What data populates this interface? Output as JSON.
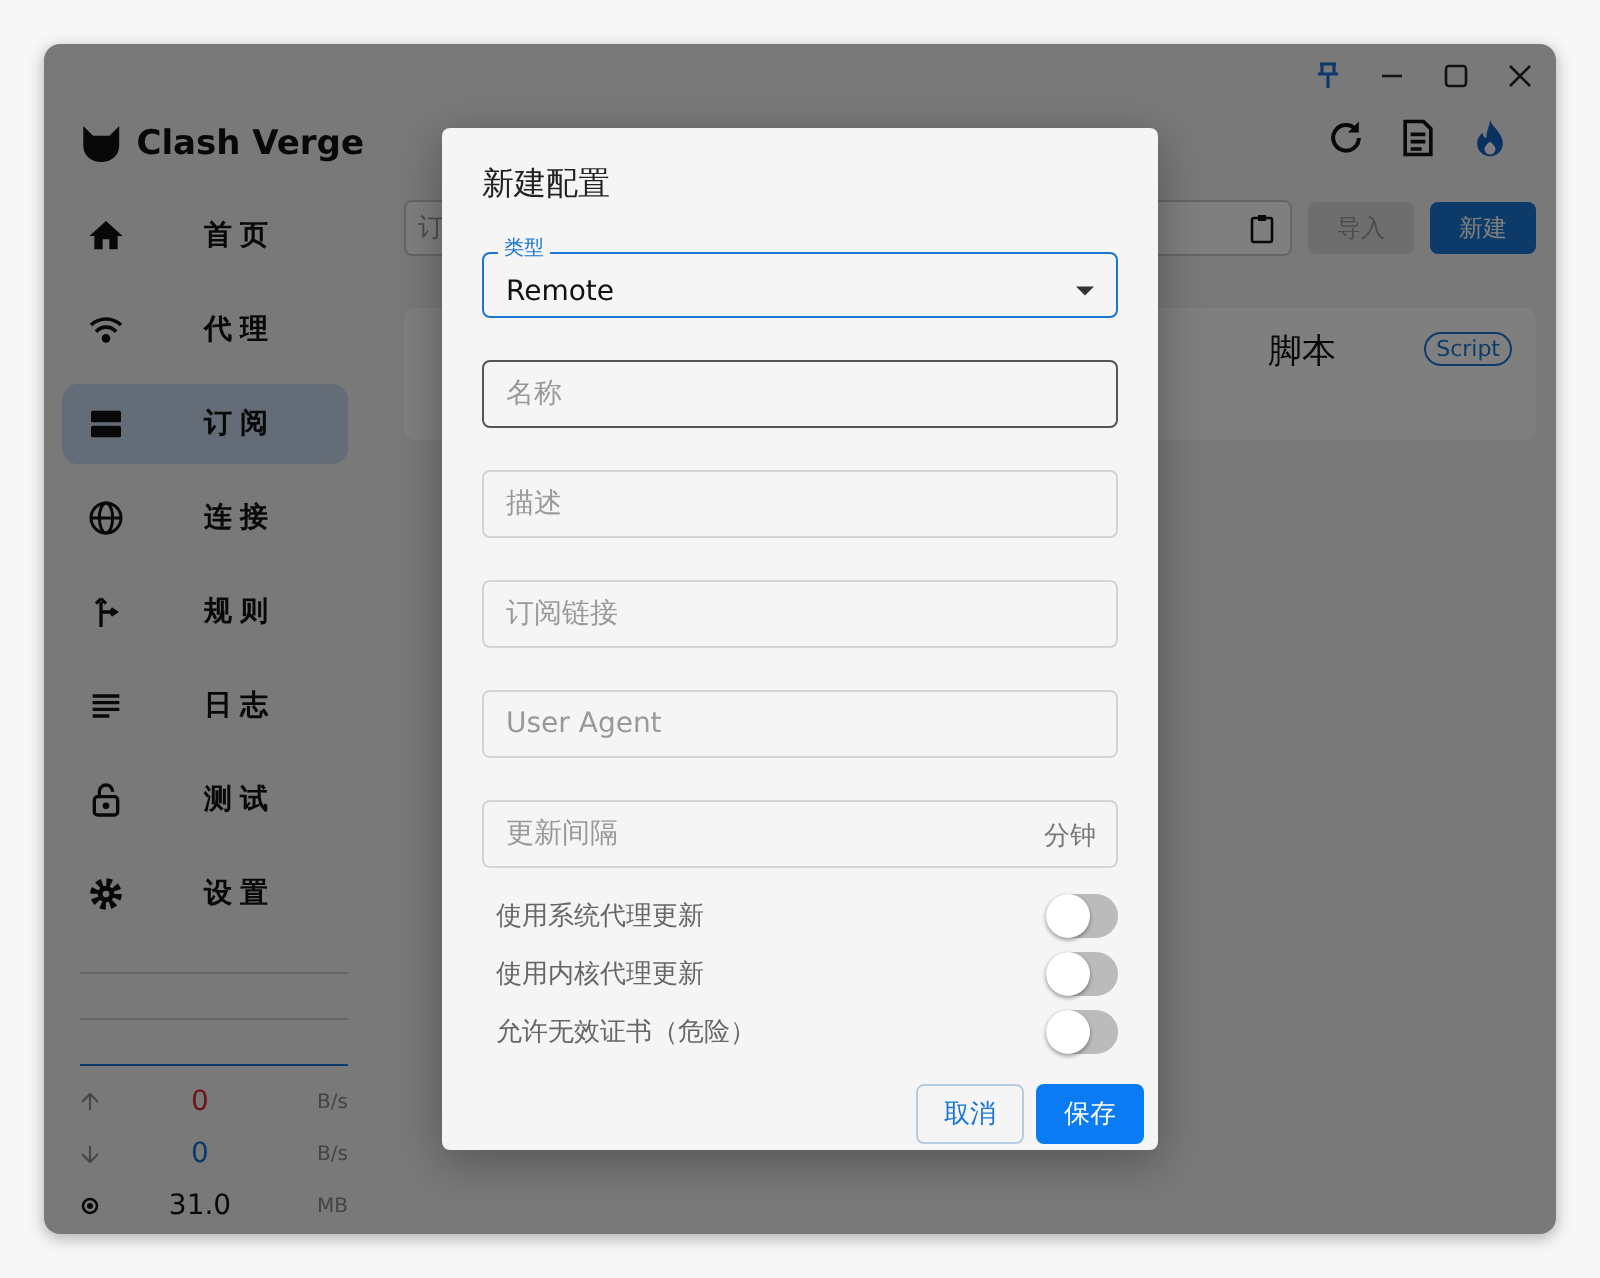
{
  "app": {
    "name": "Clash Verge"
  },
  "nav": [
    {
      "label": "首页",
      "selected": false
    },
    {
      "label": "代理",
      "selected": false
    },
    {
      "label": "订阅",
      "selected": true
    },
    {
      "label": "连接",
      "selected": false
    },
    {
      "label": "规则",
      "selected": false
    },
    {
      "label": "日志",
      "selected": false
    },
    {
      "label": "测试",
      "selected": false
    },
    {
      "label": "设置",
      "selected": false
    }
  ],
  "traffic": {
    "upload": "0",
    "upload_unit": "B/s",
    "download": "0",
    "download_unit": "B/s",
    "memory": "31.0",
    "memory_unit": "MB"
  },
  "page": {
    "search_placeholder": "订",
    "buttons": [
      {
        "label": "导入",
        "kind": "secondary"
      },
      {
        "label": "新建",
        "kind": "primary"
      }
    ],
    "card": {
      "text_right": "脚本",
      "tag": "Script"
    }
  },
  "dialog": {
    "title": "新建配置",
    "type_field": {
      "label": "类型",
      "value": "Remote"
    },
    "fields": [
      {
        "placeholder": "名称",
        "hovered": true
      },
      {
        "placeholder": "描述",
        "hovered": false
      },
      {
        "placeholder": "订阅链接",
        "hovered": false
      },
      {
        "placeholder": "User Agent",
        "hovered": false
      },
      {
        "placeholder": "更新间隔",
        "suffix": "分钟",
        "hovered": false
      }
    ],
    "toggles": [
      {
        "label": "使用系统代理更新",
        "on": false
      },
      {
        "label": "使用内核代理更新",
        "on": false
      },
      {
        "label": "允许无效证书（危险）",
        "on": false
      }
    ],
    "buttons": [
      {
        "label": "取消",
        "kind": "secondary"
      },
      {
        "label": "保存",
        "kind": "primary"
      }
    ]
  }
}
